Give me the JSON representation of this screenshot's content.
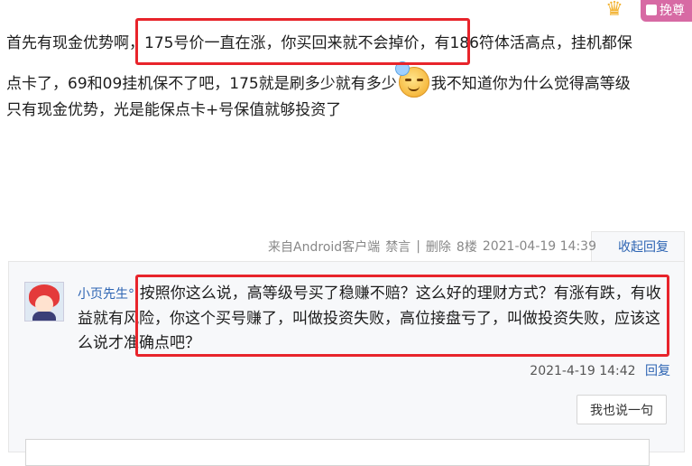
{
  "header": {
    "badge_label": "挽尊"
  },
  "post": {
    "line1": "首先有现金优势啊，175号价一直在涨，你买回来就不会掉价，有186符体活高点，挂机都保",
    "line2_a": "点卡了，69和09挂机保不了吧，175就是刷多少就有多少",
    "line2_b": "我不知道你为什么觉得高等级",
    "line3": "只有现金优势，光是能保点卡+号保值就够投资了"
  },
  "post_meta": {
    "source": "来自Android客户端",
    "ban": "禁言",
    "separator": "|",
    "delete": "删除",
    "floor": "8楼",
    "datetime": "2021-04-19 14:39",
    "collapse": "收起回复"
  },
  "reply": {
    "username": "小页先生°",
    "text": ":按照你这么说，高等级号买了稳赚不赔？这么好的理财方式？有涨有跌，有收益就有风险，你这个买号赚了，叫做投资失败，高位接盘亏了，叫做投资失败，应该这么说才准确点吧？",
    "datetime": "2021-4-19 14:42",
    "reply_label": "回复"
  },
  "actions": {
    "say_button": "我也说一句"
  },
  "colors": {
    "highlight_box": "#e8242b",
    "link": "#2d64b3",
    "badge": "#d76aa4"
  }
}
